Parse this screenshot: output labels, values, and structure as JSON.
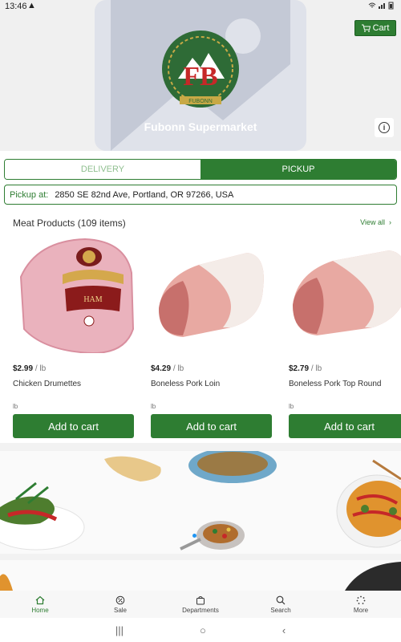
{
  "status_bar": {
    "time": "13:46",
    "warning_icon": "warning-icon",
    "right_icons": "wifi signal battery"
  },
  "header": {
    "store_name": "Fubonn Supermarket",
    "cart_label": "Cart",
    "logo_text": "FB",
    "logo_subtext": "FUBONN",
    "accent_color": "#2e7d32"
  },
  "mode_toggle": {
    "delivery_label": "DELIVERY",
    "pickup_label": "PICKUP",
    "selected": "PICKUP"
  },
  "pickup": {
    "label": "Pickup at:",
    "address": "2850 SE 82nd Ave, Portland, OR 97266, USA"
  },
  "section": {
    "title": "Meat Products (109 items)",
    "view_all": "View all"
  },
  "products": [
    {
      "price": "$2.99",
      "unit_suffix": "/ lb",
      "name": "Chicken Drumettes",
      "unit": "lb",
      "button": "Add to cart",
      "image": "ham"
    },
    {
      "price": "$4.29",
      "unit_suffix": "/ lb",
      "name": "Boneless Pork Loin",
      "unit": "lb",
      "button": "Add to cart",
      "image": "pork-loin"
    },
    {
      "price": "$2.79",
      "unit_suffix": "/ lb",
      "name": "Boneless Pork Top Round",
      "unit": "lb",
      "button": "Add to cart",
      "image": "pork-round"
    }
  ],
  "bottom_nav": [
    {
      "label": "Home",
      "icon": "home-icon",
      "active": true
    },
    {
      "label": "Sale",
      "icon": "sale-icon",
      "active": false
    },
    {
      "label": "Departments",
      "icon": "bag-icon",
      "active": false
    },
    {
      "label": "Search",
      "icon": "search-icon",
      "active": false
    },
    {
      "label": "More",
      "icon": "more-icon",
      "active": false
    }
  ],
  "system_nav": {
    "recents": "|||",
    "home": "○",
    "back": "‹"
  }
}
